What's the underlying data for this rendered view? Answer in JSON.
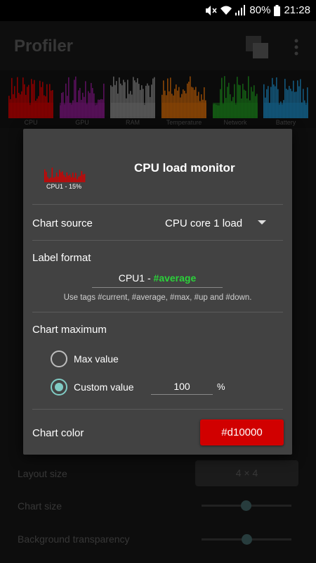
{
  "status": {
    "battery": "80%",
    "time": "21:28"
  },
  "app": {
    "title": "Profiler"
  },
  "tiles": [
    {
      "label": "CPU",
      "color": "#d10000"
    },
    {
      "label": "GPU",
      "color": "#8b1a8e"
    },
    {
      "label": "RAM",
      "color": "#8a8a8a"
    },
    {
      "label": "Temperature",
      "color": "#d46a0a"
    },
    {
      "label": "Network",
      "color": "#1f8f1f"
    },
    {
      "label": "Battery",
      "color": "#1e88c0"
    }
  ],
  "background": {
    "layout_size_label": "Layout size",
    "layout_size_value": "4 × 4",
    "chart_size_label": "Chart size",
    "chart_size_level": 0.5,
    "bg_transparency_label": "Background transparency",
    "bg_transparency_level": 0.5
  },
  "dialog": {
    "title": "CPU load monitor",
    "preview_label": "CPU1 - 15%",
    "chart_source_label": "Chart source",
    "chart_source_value": "CPU core 1 load",
    "label_format_label": "Label format",
    "label_format_prefix": "CPU1 - ",
    "label_format_tag": "#average",
    "hint": "Use tags #current, #average, #max, #up and #down.",
    "chart_maximum_label": "Chart maximum",
    "max_value_label": "Max value",
    "custom_value_label": "Custom value",
    "custom_value": "100",
    "percent": "%",
    "chart_color_label": "Chart color",
    "chart_color_value": "#d10000"
  }
}
